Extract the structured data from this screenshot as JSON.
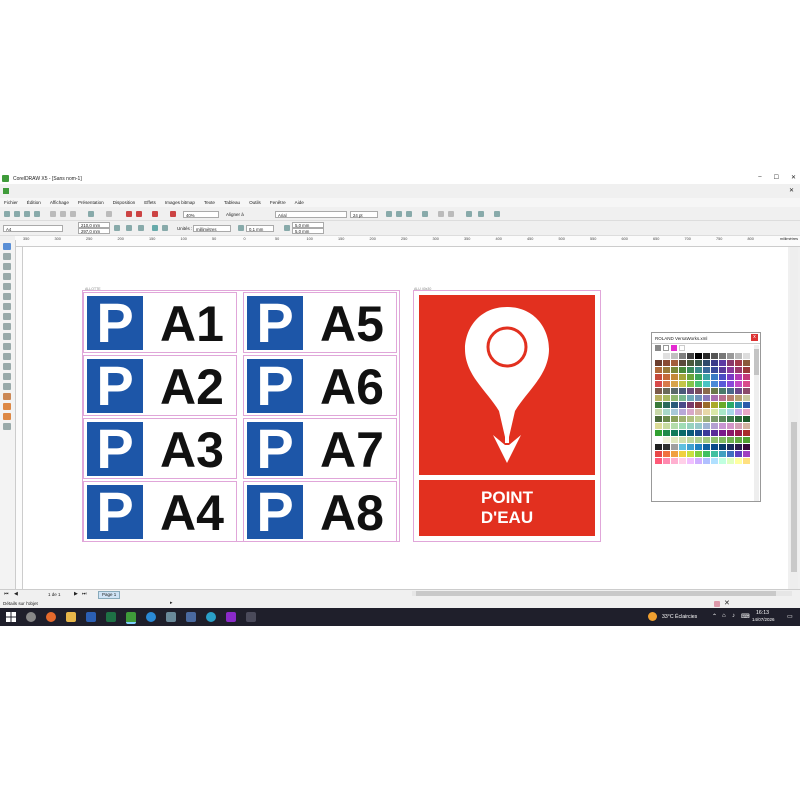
{
  "window": {
    "title": "CorelDRAW X5 - [Sans nom-1]",
    "min_label": "–",
    "max_label": "☐",
    "close_label": "✕"
  },
  "menu": [
    "Fichier",
    "Édition",
    "Affichage",
    "Présentation",
    "Disposition",
    "Effets",
    "Images bitmap",
    "Texte",
    "Tableau",
    "Outils",
    "Fenêtre",
    "Aide"
  ],
  "toolbar": {
    "zoom": "40%",
    "snap": "Aligner à",
    "font": "Arial",
    "font_size": "24 pt"
  },
  "property_bar": {
    "page_size": "A4",
    "width": "210,0 mm",
    "height": "297,0 mm",
    "units_label": "Unités :",
    "units": "millimètres",
    "nudge": "0,1 mm",
    "dup_x": "5,0 mm",
    "dup_y": "5,0 mm"
  },
  "ruler_unit": "millimètres",
  "ruler_ticks": [
    "350",
    "300",
    "250",
    "200",
    "150",
    "100",
    "50",
    "0",
    "50",
    "100",
    "150",
    "200",
    "250",
    "300",
    "350",
    "400",
    "450",
    "500",
    "550",
    "600",
    "650",
    "700",
    "750",
    "800"
  ],
  "canvas": {
    "group_label_1": "ALLOTTE",
    "group_label_2": "ALU 40x30",
    "parking_signs": [
      {
        "letter": "P",
        "code": "A1"
      },
      {
        "letter": "P",
        "code": "A2"
      },
      {
        "letter": "P",
        "code": "A3"
      },
      {
        "letter": "P",
        "code": "A4"
      },
      {
        "letter": "P",
        "code": "A5"
      },
      {
        "letter": "P",
        "code": "A6"
      },
      {
        "letter": "P",
        "code": "A7"
      },
      {
        "letter": "P",
        "code": "A8"
      }
    ],
    "point_eau": {
      "line1": "POINT",
      "line2": "D'EAU",
      "color": "#e2301f"
    },
    "parking_blue": "#1d56a8"
  },
  "palette": {
    "title": "ROLAND VersaWorks.xml",
    "close_label": "x",
    "colors": [
      "#ffffff",
      "#e0e0e0",
      "#c0c0c0",
      "#808080",
      "#404040",
      "#000000",
      "#2a2a2a",
      "#555555",
      "#777777",
      "#999999",
      "#bbbbbb",
      "#dddddd",
      "#6b3e2e",
      "#8a4a33",
      "#a35d3b",
      "#5a4a3a",
      "#4a5a3a",
      "#3a5a4a",
      "#2e4a6b",
      "#3b3a8a",
      "#5d3ba3",
      "#8a3b6b",
      "#a33b4a",
      "#8a5a3a",
      "#b06a3a",
      "#9a7a3a",
      "#7a8a3a",
      "#4a8a3a",
      "#3a8a5a",
      "#3a8a8a",
      "#3a6a9a",
      "#3a4a9a",
      "#5a3a9a",
      "#8a3a9a",
      "#9a3a6a",
      "#9a3a3a",
      "#c44a3a",
      "#c46a3a",
      "#c48a3a",
      "#a4a43a",
      "#6aa43a",
      "#3aa45a",
      "#3aa4a4",
      "#3a7ac4",
      "#4a4ac4",
      "#7a3ac4",
      "#b43ab4",
      "#c43a7a",
      "#d84a4a",
      "#d87a4a",
      "#d8a44a",
      "#c4c44a",
      "#84c44a",
      "#4ac47a",
      "#4ac4c4",
      "#4a8ad8",
      "#5a5ad8",
      "#8a4ad8",
      "#c44ac4",
      "#d84a8a",
      "#7a5a4a",
      "#6a6a5a",
      "#5a6a6a",
      "#4a5a7a",
      "#6a4a7a",
      "#7a4a5a",
      "#8a6a4a",
      "#6a7a4a",
      "#4a7a6a",
      "#4a6a8a",
      "#6a4a8a",
      "#8a4a6a",
      "#b8b060",
      "#a8b860",
      "#90b870",
      "#78b890",
      "#70a8b8",
      "#7090b8",
      "#8878b8",
      "#a870b0",
      "#b87090",
      "#b88070",
      "#b8a070",
      "#c8c8a0",
      "#3a7a3a",
      "#2a6a5a",
      "#2a5a7a",
      "#4a4a8a",
      "#7a3a6a",
      "#8a3a3a",
      "#9a6a2a",
      "#aaaa2a",
      "#6aaa2a",
      "#2aaa6a",
      "#2a8aaa",
      "#2a5aaa",
      "#c8d8a8",
      "#a8d8c8",
      "#a8c8d8",
      "#b8a8d8",
      "#d8a8c8",
      "#d8b8a8",
      "#e8d8a8",
      "#d8e8a8",
      "#a8e8c8",
      "#a8d8e8",
      "#c8a8e8",
      "#e8a8c8",
      "#4a6a3a",
      "#6a8a4a",
      "#8aa05a",
      "#a0b070",
      "#b0c080",
      "#c0d090",
      "#9ab07a",
      "#7a9a6a",
      "#5a8a5a",
      "#3a7a4a",
      "#2a6a3a",
      "#1a5a2a",
      "#dcdc96",
      "#c8dca0",
      "#b4dcaa",
      "#a0dcb4",
      "#96d2be",
      "#96c8c8",
      "#a0b4d2",
      "#b4a0d2",
      "#c896d2",
      "#d296c8",
      "#d2a0b4",
      "#d2b4a0",
      "#30a030",
      "#208a48",
      "#107a5a",
      "#0a6a6a",
      "#0a5a7a",
      "#1a4a8a",
      "#3a3a9a",
      "#5a2a9a",
      "#7a1a8a",
      "#8a1a6a",
      "#9a1a4a",
      "#aa2a2a",
      "#ffffff",
      "#f0f0d8",
      "#e0e8c0",
      "#d0e0b0",
      "#c0d8a0",
      "#b0d090",
      "#a0c880",
      "#90c070",
      "#80b860",
      "#70b050",
      "#60a840",
      "#50a030",
      "#202020",
      "#303030",
      "#a0a0a0",
      "#60c0e0",
      "#40a0d0",
      "#2080c0",
      "#1060a0",
      "#0a4a8a",
      "#0a3a6a",
      "#1a2a5a",
      "#2a1a4a",
      "#3a0a3a",
      "#e84848",
      "#f07040",
      "#f0a040",
      "#f0d040",
      "#c8e040",
      "#80d040",
      "#40c060",
      "#40c0a0",
      "#40a0c0",
      "#4070c0",
      "#6040c0",
      "#a040c0",
      "#ff5a78",
      "#ff8ab0",
      "#ffb0d0",
      "#ffd0e8",
      "#f0c0ff",
      "#d0b0ff",
      "#b0c0ff",
      "#b0e0ff",
      "#c0ffe0",
      "#e0ffc0",
      "#ffffa0",
      "#ffe080"
    ]
  },
  "pagebar": {
    "page_count": "1 de 1",
    "page_tab": "Page 1"
  },
  "status": {
    "text": "Détails sur l'objet"
  },
  "taskbar": {
    "weather": "33°C  Éclaircies",
    "time": "16:13",
    "date": "14/07/2026"
  }
}
